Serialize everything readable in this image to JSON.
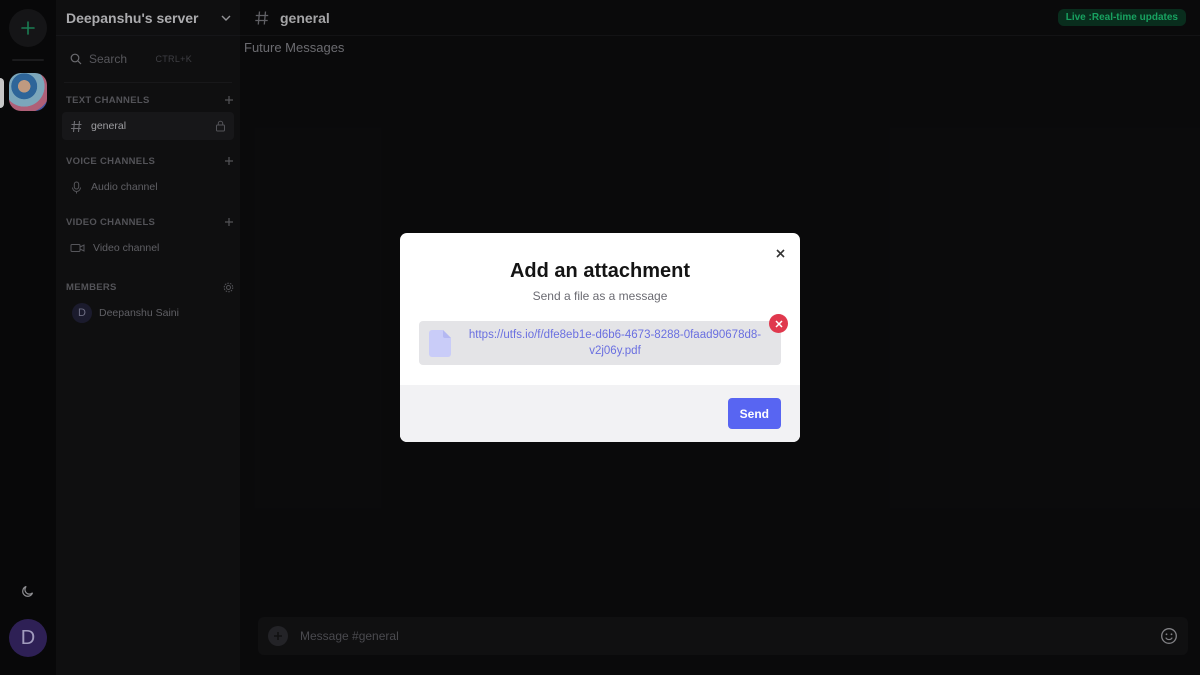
{
  "server": {
    "name": "Deepanshu's server"
  },
  "sidebar": {
    "search_label": "Search",
    "search_shortcut": "CTRL+K",
    "sections": {
      "text": "TEXT CHANNELS",
      "voice": "VOICE CHANNELS",
      "video": "VIDEO CHANNELS",
      "members": "MEMBERS"
    },
    "channels": {
      "text": "general",
      "voice": "Audio channel",
      "video": "Video channel"
    },
    "member": {
      "initial": "D",
      "name": "Deepanshu Saini"
    }
  },
  "rail": {
    "user_initial": "D"
  },
  "main": {
    "channel_title": "general",
    "live_badge": "Live :Real-time updates",
    "future_messages": "Future Messages",
    "composer_placeholder": "Message #general"
  },
  "modal": {
    "title": "Add an attachment",
    "subtitle": "Send a file as a message",
    "file_url": "https://utfs.io/f/dfe8eb1e-d6b6-4673-8288-0faad90678d8-v2j06y.pdf",
    "send_label": "Send"
  },
  "colors": {
    "accent": "#5865f2",
    "live_green": "#1fcf7b",
    "danger": "#e0384d",
    "link": "#6a6fe0"
  }
}
